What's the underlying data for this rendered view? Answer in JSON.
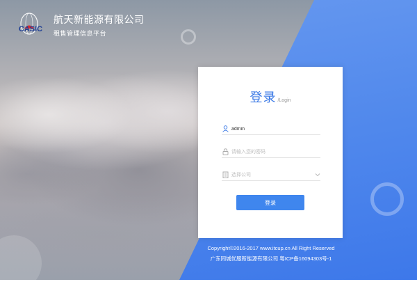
{
  "brand": {
    "logo_text": "CASIC",
    "title": "航天新能源有限公司",
    "subtitle": "租售管理信息平台"
  },
  "login": {
    "title": "登录",
    "subtitle": "/Login",
    "username_value": "admin",
    "password_placeholder": "请输入您的密码",
    "company_placeholder": "选择公司",
    "submit_label": "登录"
  },
  "footer": {
    "copyright": "Copyright©2016-2017 www.itcup.cn All Right Reserved",
    "icp": "广东同城优服新能源有限公司 粤ICP备16094303号-1"
  },
  "colors": {
    "accent": "#3f86ee",
    "title": "#3c7ae6",
    "panel": "#5088ec"
  },
  "icons": {
    "user": "user-icon",
    "lock": "lock-icon",
    "company": "building-icon",
    "dropdown": "chevron-down-icon"
  }
}
